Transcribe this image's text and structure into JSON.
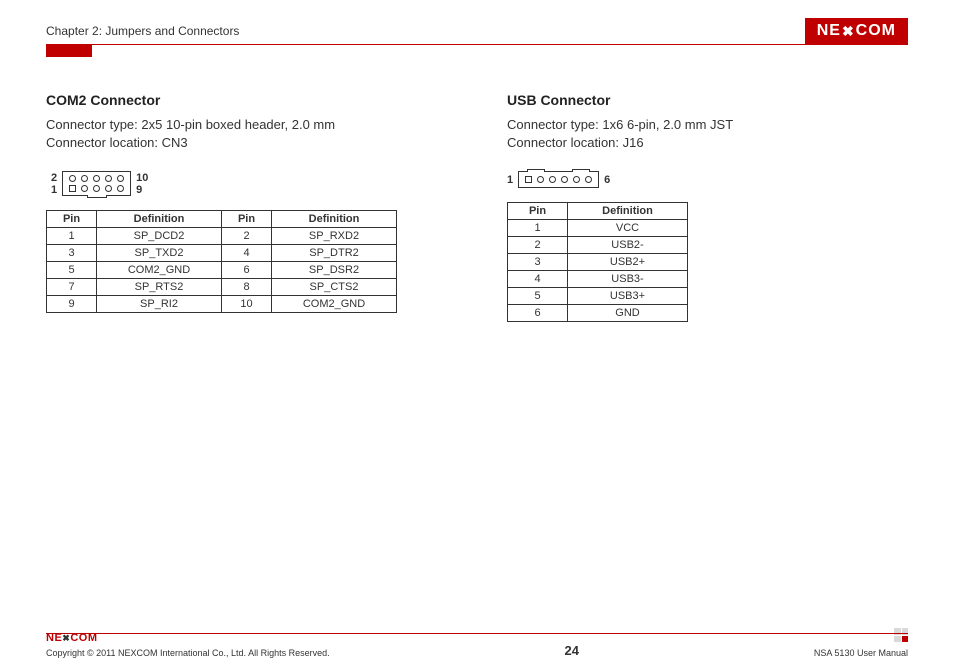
{
  "header": {
    "chapter": "Chapter 2: Jumpers and Connectors",
    "logo_l": "NE",
    "logo_dash": "✖",
    "logo_r": "COM"
  },
  "com2": {
    "title": "COM2 Connector",
    "type": "Connector type: 2x5 10-pin boxed header, 2.0 mm",
    "loc": "Connector location: CN3",
    "dNumTL": "2",
    "dNumBL": "1",
    "dNumTR": "10",
    "dNumBR": "9",
    "thPin": "Pin",
    "thDef": "Definition",
    "rows": [
      {
        "p1": "1",
        "d1": "SP_DCD2",
        "p2": "2",
        "d2": "SP_RXD2"
      },
      {
        "p1": "3",
        "d1": "SP_TXD2",
        "p2": "4",
        "d2": "SP_DTR2"
      },
      {
        "p1": "5",
        "d1": "COM2_GND",
        "p2": "6",
        "d2": "SP_DSR2"
      },
      {
        "p1": "7",
        "d1": "SP_RTS2",
        "p2": "8",
        "d2": "SP_CTS2"
      },
      {
        "p1": "9",
        "d1": "SP_RI2",
        "p2": "10",
        "d2": "COM2_GND"
      }
    ]
  },
  "usb": {
    "title": "USB Connector",
    "type": "Connector type: 1x6 6-pin, 2.0 mm JST",
    "loc": "Connector location: J16",
    "dL": "1",
    "dR": "6",
    "thPin": "Pin",
    "thDef": "Definition",
    "rows": [
      {
        "p": "1",
        "d": "VCC"
      },
      {
        "p": "2",
        "d": "USB2-"
      },
      {
        "p": "3",
        "d": "USB2+"
      },
      {
        "p": "4",
        "d": "USB3-"
      },
      {
        "p": "5",
        "d": "USB3+"
      },
      {
        "p": "6",
        "d": "GND"
      }
    ]
  },
  "footer": {
    "copyright": "Copyright © 2011 NEXCOM International Co., Ltd. All Rights Reserved.",
    "page": "24",
    "manual": "NSA 5130 User Manual",
    "logo_l": "NE",
    "logo_dash": "✖",
    "logo_r": "COM"
  }
}
